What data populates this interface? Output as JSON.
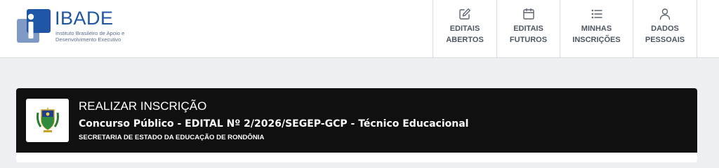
{
  "brand": {
    "name": "IBADE",
    "subtitle": "Instituto Brasileiro de Apoio e Desenvolvimento Executivo",
    "color": "#1f57a6"
  },
  "nav": {
    "items": [
      {
        "label": "EDITAIS\nABERTOS",
        "icon": "edit-icon"
      },
      {
        "label": "EDITAIS\nFUTUROS",
        "icon": "calendar-icon"
      },
      {
        "label": "MINHAS\nINSCRIÇÕES",
        "icon": "list-icon"
      },
      {
        "label": "DADOS\nPESSOAIS",
        "icon": "user-icon"
      }
    ]
  },
  "page": {
    "action": "REALIZAR INSCRIÇÃO",
    "title": "Concurso Público - EDITAL Nº 2/2026/SEGEP-GCP - Técnico Educacional",
    "organization": "SECRETARIA DE ESTADO DA EDUCAÇÃO DE RONDÔNIA",
    "header_bg": "#101010"
  }
}
